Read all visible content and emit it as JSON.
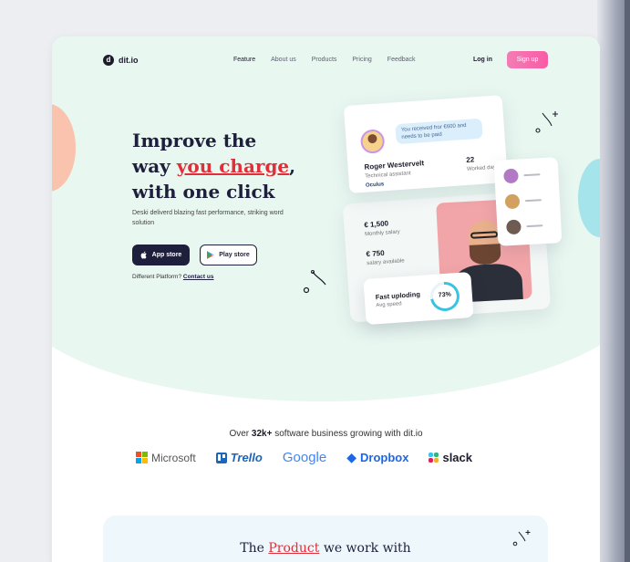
{
  "brand": {
    "logo_letter": "d",
    "name": "dit.io"
  },
  "nav": {
    "links": [
      "Feature",
      "About us",
      "Products",
      "Pricing",
      "Feedback"
    ],
    "login": "Log in",
    "signup": "Sign up"
  },
  "hero": {
    "headline_line1": "Improve the",
    "headline_pre": "way ",
    "headline_highlight": "you charge",
    "headline_post": ",",
    "headline_line3": "with one click",
    "subtext": "Deski deliverd blazing fast performance, striking word solution",
    "app_store": "App store",
    "play_store": "Play store",
    "platform_text": "Different Platform?",
    "platform_link": "Contact us"
  },
  "profile_card": {
    "message": "You received fror €600 and needs to be paid",
    "name": "Roger Westervelt",
    "role": "Technical assistant",
    "company": "Oculus",
    "worked_days_value": "22",
    "worked_days_label": "Worked days"
  },
  "salary_card": {
    "monthly_value": "€ 1,500",
    "monthly_label": "Monthly salary",
    "available_value": "€ 750",
    "available_label": "salary available"
  },
  "speed_card": {
    "title": "Fast uploding",
    "subtitle": "Avg speed",
    "percent": "73%",
    "percent_value": 0.73
  },
  "colors": {
    "accent_pink": "#f95ba6",
    "headline_red": "#e12f3a",
    "hero_bg": "#e9f7f1",
    "navy": "#1e1f3c"
  },
  "trust": {
    "prefix": "Over ",
    "count": "32k+",
    "suffix": " software business growing with dit.io",
    "logos": [
      "Microsoft",
      "Trello",
      "Google",
      "Dropbox",
      "slack"
    ]
  },
  "product_section": {
    "title_pre": "The ",
    "title_highlight": "Product",
    "title_post": " we work with"
  }
}
